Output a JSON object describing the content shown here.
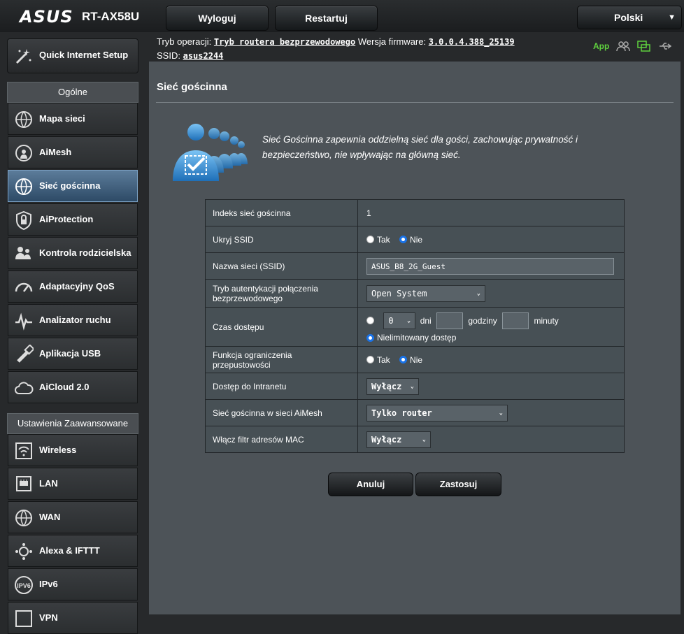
{
  "header": {
    "brand": "ASUS",
    "model": "RT-AX58U",
    "logout_label": "Wyloguj",
    "restart_label": "Restartuj",
    "language": "Polski"
  },
  "status": {
    "op_mode_label": "Tryb operacji:",
    "op_mode_value": "Tryb routera bezprzewodowego",
    "firmware_label": "Wersja firmware:",
    "firmware_value": "3.0.0.4.388_25139",
    "ssid_label": "SSID:",
    "ssid_value": "asus2244",
    "app_label": "App"
  },
  "sidebar": {
    "quick_setup": "Quick Internet Setup",
    "general_header": "Ogólne",
    "general_items": [
      {
        "label": "Mapa sieci",
        "icon": "network-map-icon"
      },
      {
        "label": "AiMesh",
        "icon": "aimesh-icon"
      },
      {
        "label": "Sieć gościnna",
        "icon": "guest-network-icon"
      },
      {
        "label": "AiProtection",
        "icon": "shield-lock-icon"
      },
      {
        "label": "Kontrola rodzicielska",
        "icon": "parental-control-icon"
      },
      {
        "label": "Adaptacyjny QoS",
        "icon": "gauge-icon"
      },
      {
        "label": "Analizator ruchu",
        "icon": "traffic-analyzer-icon"
      },
      {
        "label": "Aplikacja USB",
        "icon": "usb-icon"
      },
      {
        "label": "AiCloud 2.0",
        "icon": "cloud-icon"
      }
    ],
    "advanced_header": "Ustawienia Zaawansowane",
    "advanced_items": [
      {
        "label": "Wireless",
        "icon": "wireless-icon"
      },
      {
        "label": "LAN",
        "icon": "lan-icon"
      },
      {
        "label": "WAN",
        "icon": "wan-globe-icon"
      },
      {
        "label": "Alexa & IFTTT",
        "icon": "alexa-icon"
      },
      {
        "label": "IPv6",
        "icon": "ipv6-icon"
      },
      {
        "label": "VPN",
        "icon": "vpn-icon"
      }
    ]
  },
  "main": {
    "title": "Sieć gościnna",
    "description": "Sieć Gościnna zapewnia oddzielną sieć dla gości, zachowując prywatność i bezpieczeństwo, nie wpływając na główną sieć.",
    "rows": {
      "index_label": "Indeks sieć gościnna",
      "index_value": "1",
      "hide_ssid_label": "Ukryj SSID",
      "yes": "Tak",
      "no": "Nie",
      "ssid_label": "Nazwa sieci (SSID)",
      "ssid_value": "ASUS_B8_2G_Guest",
      "auth_label": "Tryb autentykacji połączenia bezprzewodowego",
      "auth_value": "Open System",
      "access_time_label": "Czas dostępu",
      "days_value": "0",
      "days_unit": "dni",
      "hours_unit": "godziny",
      "minutes_unit": "minuty",
      "unlimited_label": "Nielimitowany dostęp",
      "bandwidth_label": "Funkcja ograniczenia przepustowości",
      "intranet_label": "Dostęp do Intranetu",
      "intranet_value": "Wyłącz",
      "aimesh_label": "Sieć gościnna w sieci AiMesh",
      "aimesh_value": "Tylko router",
      "mac_filter_label": "Włącz filtr adresów MAC",
      "mac_filter_value": "Wyłącz"
    },
    "cancel_label": "Anuluj",
    "apply_label": "Zastosuj"
  }
}
